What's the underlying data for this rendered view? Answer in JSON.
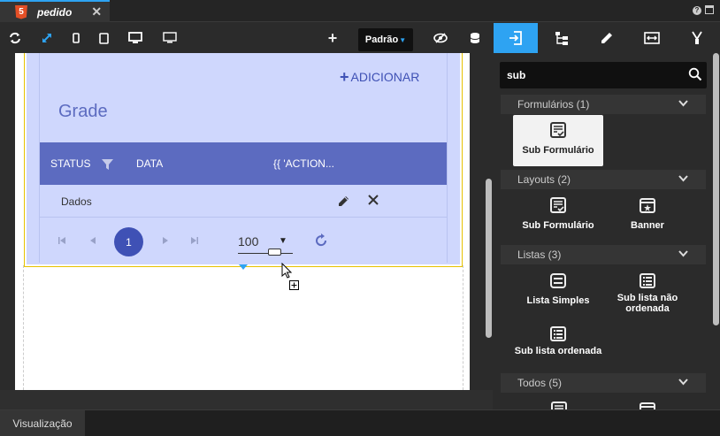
{
  "tabbar": {
    "tab_title": "pedido",
    "tab_close": "✕",
    "html5_badge": "5",
    "help": "?"
  },
  "toolbar": {
    "device_label": "Padrão",
    "icons": [
      "refresh-icon",
      "expand-icon",
      "phone-icon",
      "tablet-icon",
      "desktop-icon",
      "monitor-icon",
      "add-icon",
      "visibility-icon",
      "database-icon"
    ]
  },
  "grid": {
    "add_label": "ADICIONAR",
    "title": "Grade",
    "columns": [
      "STATUS",
      "DATA",
      "{{ 'ACTION..."
    ],
    "rows": [
      {
        "value": "Dados"
      }
    ],
    "pagination": {
      "current_page": "1",
      "page_size": "100"
    }
  },
  "panel": {
    "search": {
      "value": "sub",
      "placeholder": ""
    },
    "categories": [
      {
        "label": "Formulários (1)",
        "items": [
          "Sub Formulário"
        ]
      },
      {
        "label": "Layouts (2)",
        "items": [
          "Sub Formulário",
          "Banner"
        ]
      },
      {
        "label": "Listas (3)",
        "items": [
          "Lista Simples",
          "Sub lista não ordenada",
          "Sub lista ordenada"
        ]
      },
      {
        "label": "Todos (5)",
        "items": []
      }
    ]
  },
  "bottom": {
    "tab_label": "Visualização"
  },
  "colors": {
    "accent": "#2ea3f2",
    "grid_header": "#5c6bc0",
    "grid_bg": "#cfd7fd",
    "primary": "#3f51b5",
    "selection": "#e6c200"
  }
}
